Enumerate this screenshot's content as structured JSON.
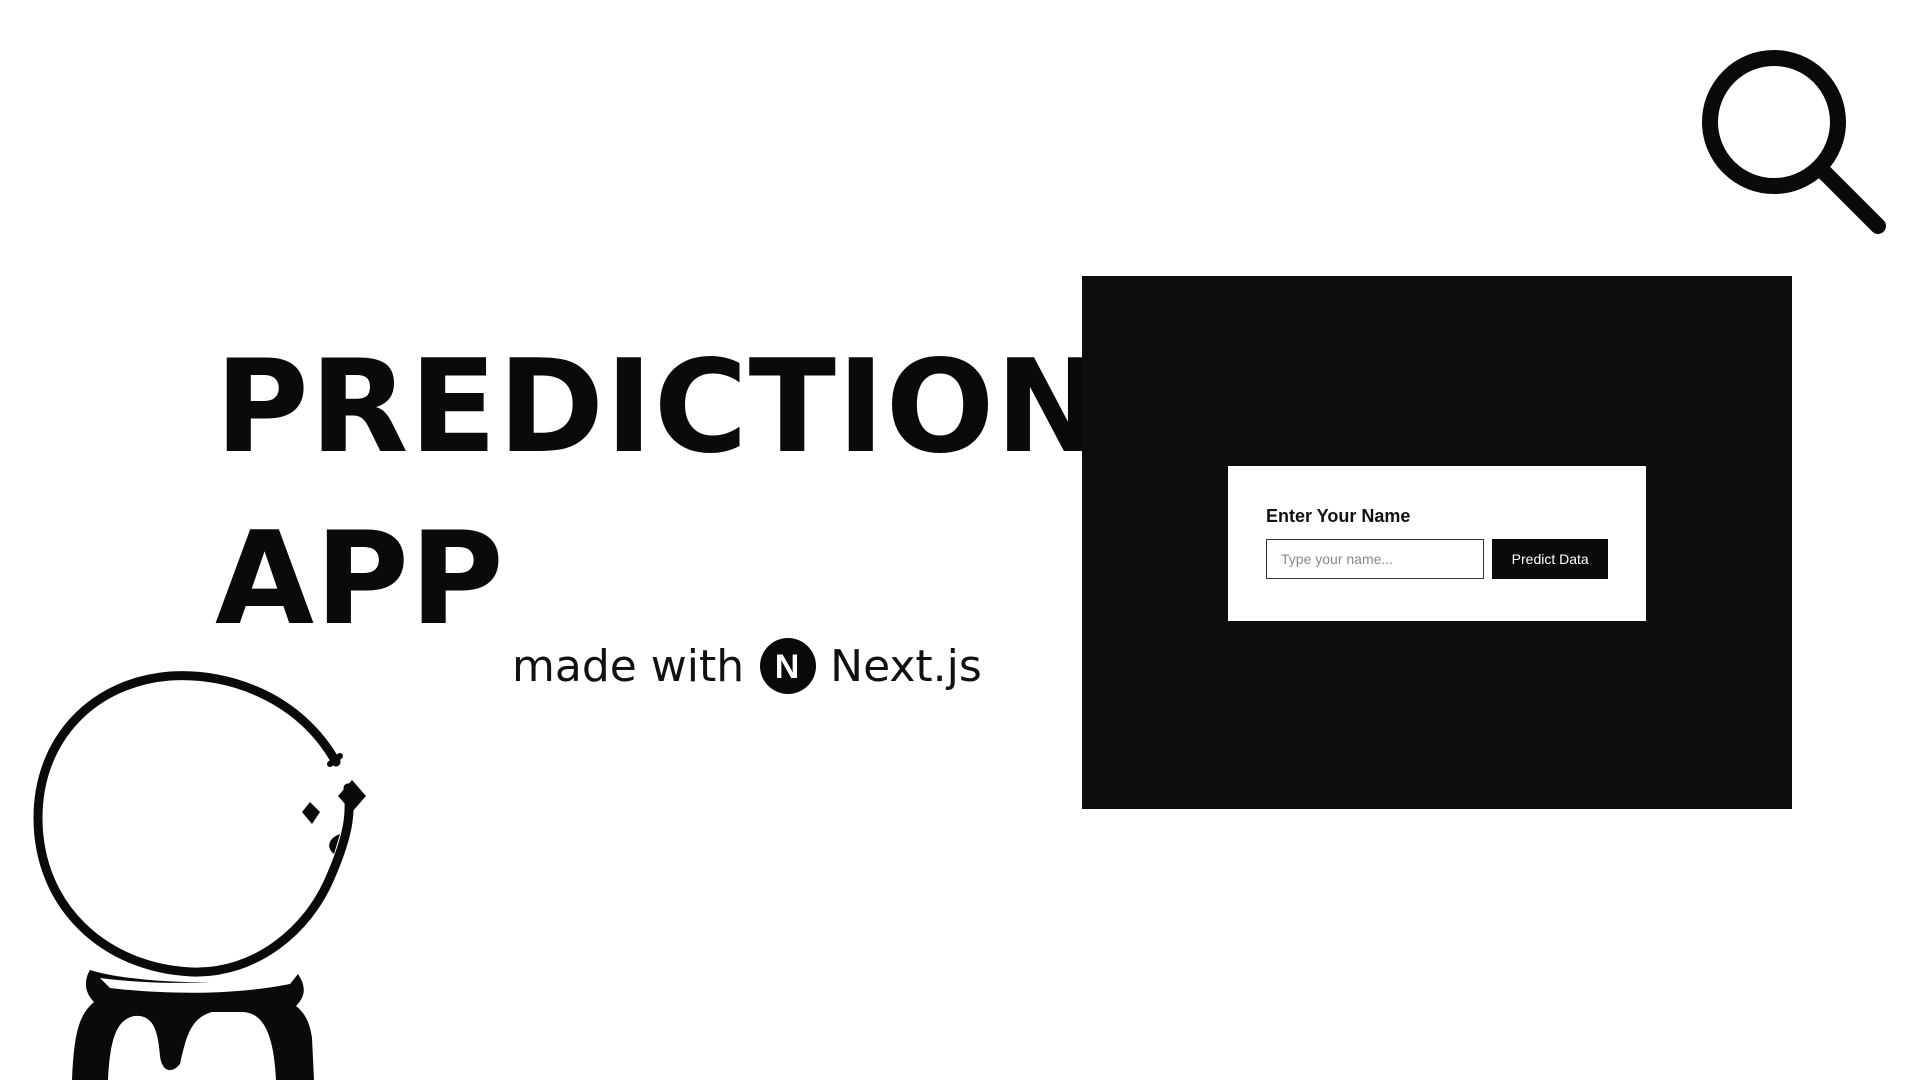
{
  "hero": {
    "title_line1": "PREDICTION",
    "title_line2": "APP",
    "made_with_label": "made with",
    "framework_name": "Next.js",
    "framework_logo_letter": "N"
  },
  "decorations": {
    "search": "search-icon",
    "mascot": "crystal-ball-icon"
  },
  "preview": {
    "form_label": "Enter Your Name",
    "input_placeholder": "Type your name...",
    "input_value": "",
    "button_label": "Predict Data"
  },
  "colors": {
    "background": "#ffffff",
    "ink": "#0a0a0a",
    "preview_bg": "#0d0d0d"
  }
}
